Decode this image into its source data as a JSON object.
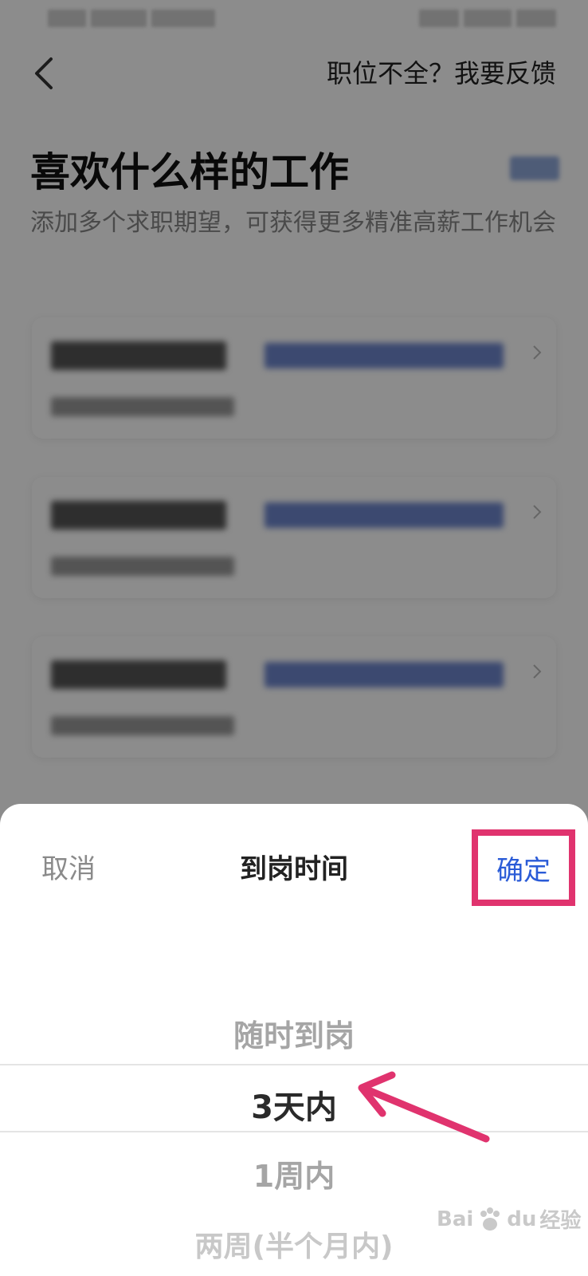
{
  "header": {
    "feedback_link": "职位不全？我要反馈"
  },
  "page": {
    "title": "喜欢什么样的工作",
    "subtitle": "添加多个求职期望，可获得更多精准高薪工作机会"
  },
  "sheet": {
    "cancel_label": "取消",
    "title": "到岗时间",
    "confirm_label": "确定",
    "options": [
      "随时到岗",
      "3天内",
      "1周内",
      "两周(半个月内)"
    ],
    "selected": "3天内"
  },
  "watermark": {
    "text": "Bai",
    "text2": "du",
    "cn": "经验"
  },
  "colors": {
    "accent": "#2a5bd7",
    "highlight": "#e0336e"
  }
}
